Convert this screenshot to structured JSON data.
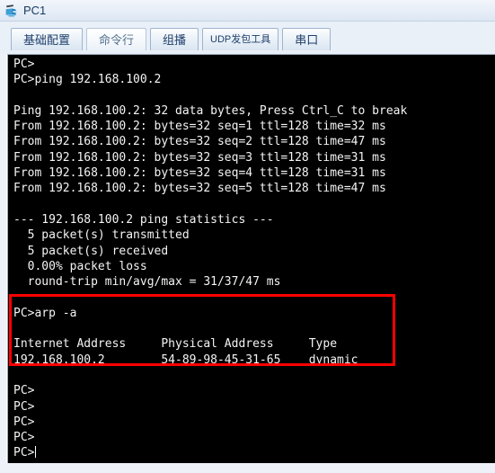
{
  "window": {
    "title": "PC1",
    "icon": "pc-device-icon"
  },
  "tabs": [
    {
      "label": "基础配置",
      "selected": false
    },
    {
      "label": "命令行",
      "selected": true
    },
    {
      "label": "组播",
      "selected": false
    },
    {
      "label": "UDP发包工具",
      "selected": false
    },
    {
      "label": "串口",
      "selected": false
    }
  ],
  "terminal": {
    "background": "#000000",
    "foreground": "#f4f4f4",
    "lines": [
      "PC>",
      "PC>ping 192.168.100.2",
      "",
      "Ping 192.168.100.2: 32 data bytes, Press Ctrl_C to break",
      "From 192.168.100.2: bytes=32 seq=1 ttl=128 time=32 ms",
      "From 192.168.100.2: bytes=32 seq=2 ttl=128 time=47 ms",
      "From 192.168.100.2: bytes=32 seq=3 ttl=128 time=31 ms",
      "From 192.168.100.2: bytes=32 seq=4 ttl=128 time=31 ms",
      "From 192.168.100.2: bytes=32 seq=5 ttl=128 time=47 ms",
      "",
      "--- 192.168.100.2 ping statistics ---",
      "  5 packet(s) transmitted",
      "  5 packet(s) received",
      "  0.00% packet loss",
      "  round-trip min/avg/max = 31/37/47 ms",
      "",
      "PC>arp -a",
      "",
      "Internet Address     Physical Address     Type",
      "192.168.100.2        54-89-98-45-31-65    dynamic",
      "",
      "PC>",
      "PC>",
      "PC>",
      "PC>",
      "PC>"
    ]
  },
  "annotation": {
    "color": "#fe0000",
    "label": "arp-output-highlight"
  }
}
